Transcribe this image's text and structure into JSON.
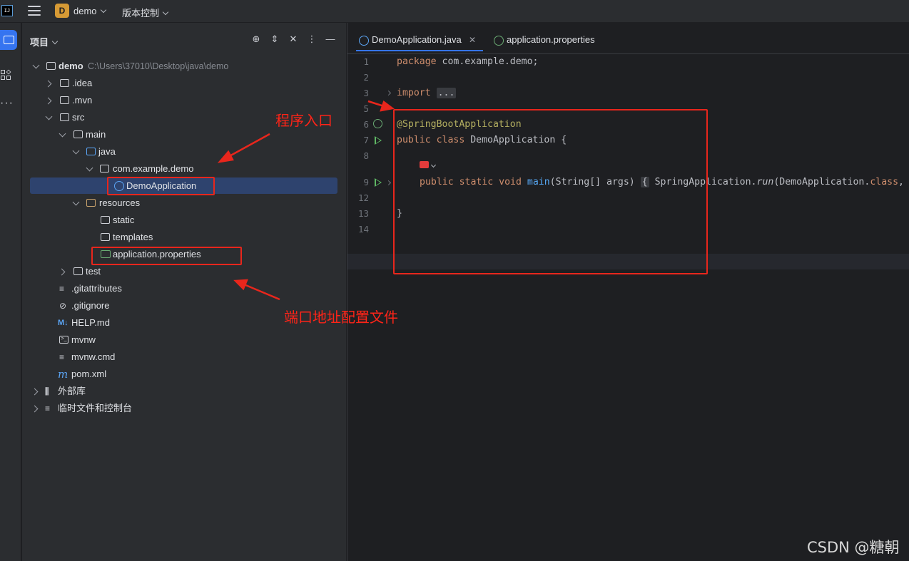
{
  "titlebar": {
    "logo": "IJ",
    "project_badge": "D",
    "project_name": "demo",
    "vcs_menu": "版本控制"
  },
  "panel": {
    "title": "项目"
  },
  "tree": [
    {
      "label": "demo",
      "hint": "C:\\Users\\37010\\Desktop\\java\\demo",
      "icon": "module-folder-icon"
    },
    {
      "label": ".idea",
      "icon": "folder-icon"
    },
    {
      "label": ".mvn",
      "icon": "folder-icon"
    },
    {
      "label": "src",
      "icon": "folder-icon"
    },
    {
      "label": "main",
      "icon": "folder-icon"
    },
    {
      "label": "java",
      "icon": "source-folder-icon"
    },
    {
      "label": "com.example.demo",
      "icon": "package-icon"
    },
    {
      "label": "DemoApplication",
      "icon": "spring-boot-class-icon"
    },
    {
      "label": "resources",
      "icon": "resources-folder-icon"
    },
    {
      "label": "static",
      "icon": "folder-icon"
    },
    {
      "label": "templates",
      "icon": "folder-icon"
    },
    {
      "label": "application.properties",
      "icon": "spring-properties-icon"
    },
    {
      "label": "test",
      "icon": "folder-icon"
    },
    {
      "label": ".gitattributes",
      "icon": "text-file-icon"
    },
    {
      "label": ".gitignore",
      "icon": "ignore-file-icon"
    },
    {
      "label": "HELP.md",
      "icon": "markdown-icon"
    },
    {
      "label": "mvnw",
      "icon": "shell-script-icon"
    },
    {
      "label": "mvnw.cmd",
      "icon": "text-file-icon"
    },
    {
      "label": "pom.xml",
      "icon": "maven-icon"
    },
    {
      "label": "外部库",
      "icon": "library-icon"
    },
    {
      "label": "临时文件和控制台",
      "icon": "scratches-icon"
    }
  ],
  "tabs": [
    {
      "label": "DemoApplication.java",
      "active": true
    },
    {
      "label": "application.properties",
      "active": false
    }
  ],
  "code": {
    "line_numbers": [
      "1",
      "2",
      "3",
      "5",
      "6",
      "7",
      "8",
      "9",
      "12",
      "13",
      "14"
    ],
    "l1_kw": "package",
    "l1_rest": " com.example.demo;",
    "l3_kw": "import",
    "l3_fold": "...",
    "l6_ann": "@SpringBootApplication",
    "l7_kw": "public class",
    "l7_rest": " DemoApplication {",
    "l9_kw": "public static void",
    "l9_fn": "main",
    "l9_args": "(String[] args) ",
    "l9_fold": "{",
    "l9_call_a": " SpringApplication.",
    "l9_call_run": "run",
    "l9_call_b": "(DemoApplication.",
    "l9_class": "class",
    "l9_tail": ",",
    "l13": "}"
  },
  "annotations": {
    "entry_label": "程序入口",
    "config_label": "端口地址配置文件"
  },
  "watermark": "CSDN @糖朝"
}
